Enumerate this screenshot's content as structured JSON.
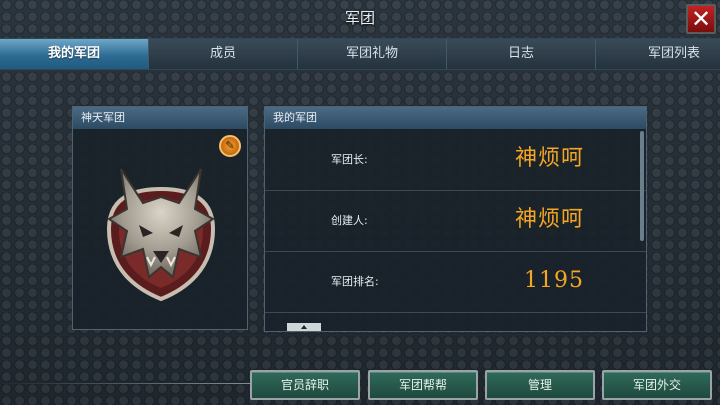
{
  "window": {
    "title": "军团",
    "close_label": "✕"
  },
  "tabs": [
    {
      "label": "我的军团",
      "active": true
    },
    {
      "label": "成员",
      "active": false
    },
    {
      "label": "军团礼物",
      "active": false
    },
    {
      "label": "日志",
      "active": false
    },
    {
      "label": "军团列表",
      "active": false
    }
  ],
  "legion_panel": {
    "header": "神天军团",
    "edit_icon": "pencil-icon",
    "emblem_icon": "wolf-shield-emblem-icon"
  },
  "info_panel": {
    "header": "我的军团",
    "rows": [
      {
        "label": "军团长:",
        "value": "神烦呵"
      },
      {
        "label": "创建人:",
        "value": "神烦呵"
      },
      {
        "label": "军团排名:",
        "value": "1195"
      }
    ]
  },
  "buttons": {
    "resign": "官员辞职",
    "help": "军团帮帮",
    "manage": "管理",
    "diplomacy": "军团外交"
  },
  "colors": {
    "accent_tab": "#2e6c93",
    "value_text": "#f5a623",
    "close_button": "#c12222",
    "button_green": "#2f6a5a"
  }
}
